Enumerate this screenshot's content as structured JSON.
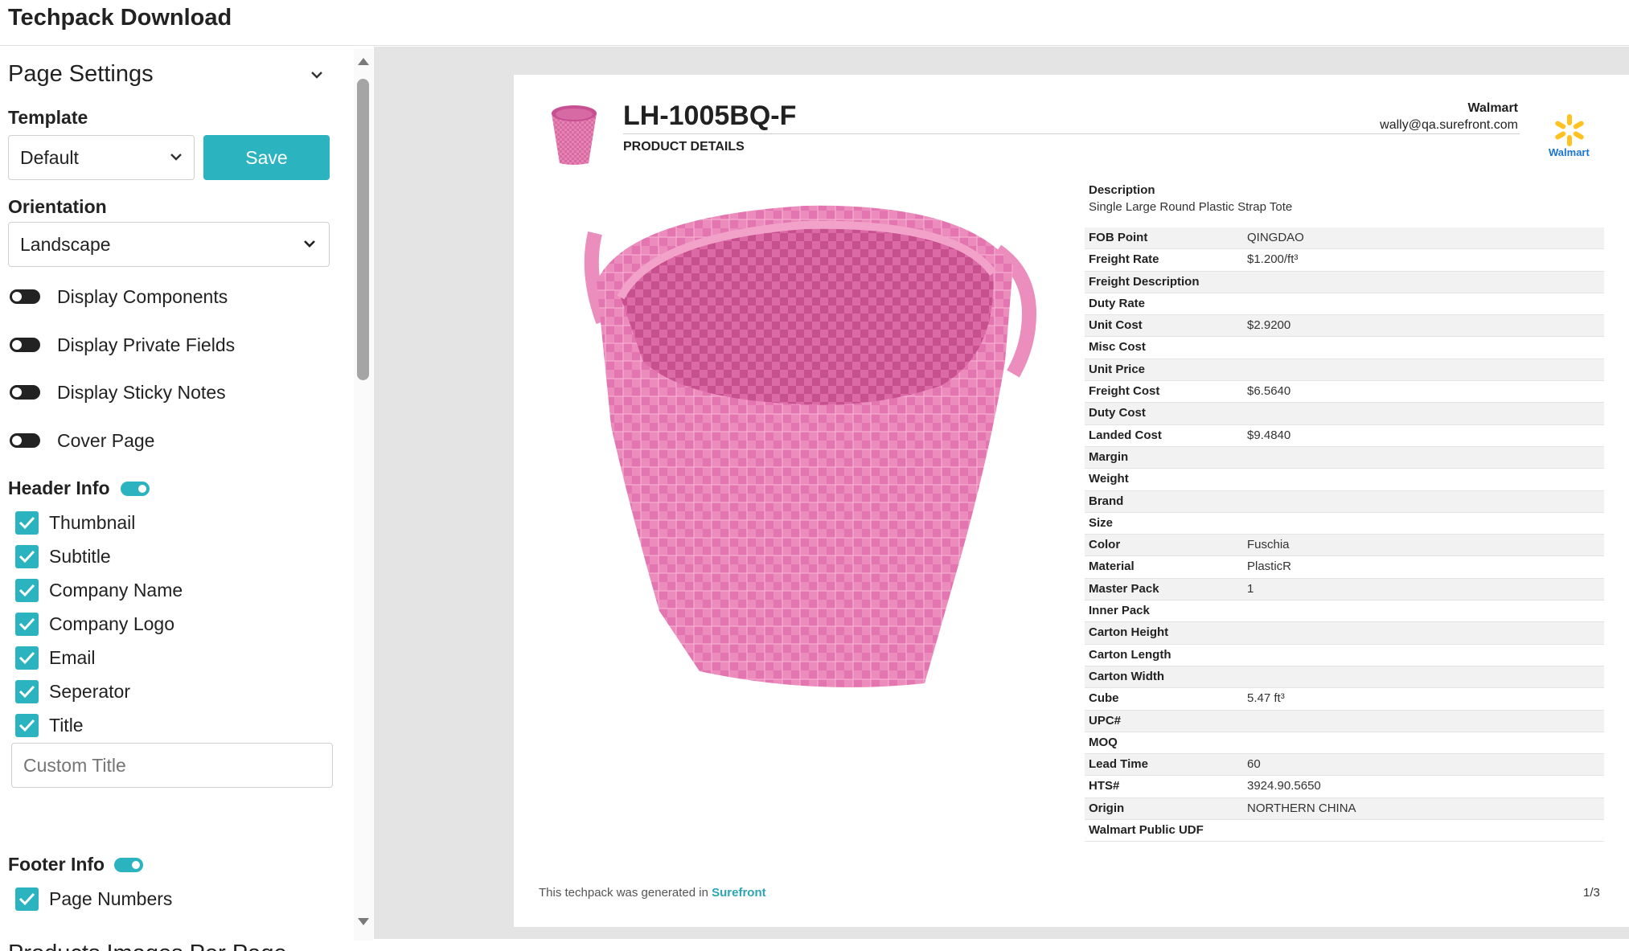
{
  "app": {
    "title": "Techpack Download"
  },
  "sidebar": {
    "page_settings": "Page Settings",
    "template_label": "Template",
    "template_value": "Default",
    "save_label": "Save",
    "orientation_label": "Orientation",
    "orientation_value": "Landscape",
    "toggles": [
      {
        "label": "Display Components",
        "on": false
      },
      {
        "label": "Display Private Fields",
        "on": false
      },
      {
        "label": "Display Sticky Notes",
        "on": false
      },
      {
        "label": "Cover Page",
        "on": false
      }
    ],
    "header_info": "Header Info",
    "header_checks": [
      {
        "label": "Thumbnail",
        "checked": true
      },
      {
        "label": "Subtitle",
        "checked": true
      },
      {
        "label": "Company Name",
        "checked": true
      },
      {
        "label": "Company Logo",
        "checked": true
      },
      {
        "label": "Email",
        "checked": true
      },
      {
        "label": "Seperator",
        "checked": true
      },
      {
        "label": "Title",
        "checked": true
      }
    ],
    "custom_title_placeholder": "Custom Title",
    "footer_info": "Footer Info",
    "footer_checks": [
      {
        "label": "Page Numbers",
        "checked": true
      }
    ],
    "products_images": "Products Images Per Page"
  },
  "preview": {
    "product_title": "LH-1005BQ-F",
    "subtitle": "PRODUCT DETAILS",
    "company": "Walmart",
    "email": "wally@qa.surefront.com",
    "logo_text": "Walmart",
    "description_label": "Description",
    "description_value": "Single Large Round Plastic Strap Tote",
    "attributes": [
      {
        "k": "FOB Point",
        "v": "QINGDAO"
      },
      {
        "k": "Freight Rate",
        "v": "$1.200/ft³"
      },
      {
        "k": "Freight Description",
        "v": ""
      },
      {
        "k": "Duty Rate",
        "v": ""
      },
      {
        "k": "Unit Cost",
        "v": "$2.9200"
      },
      {
        "k": "Misc Cost",
        "v": ""
      },
      {
        "k": "Unit Price",
        "v": ""
      },
      {
        "k": "Freight Cost",
        "v": "$6.5640"
      },
      {
        "k": "Duty Cost",
        "v": ""
      },
      {
        "k": "Landed Cost",
        "v": "$9.4840"
      },
      {
        "k": "Margin",
        "v": ""
      },
      {
        "k": "Weight",
        "v": ""
      },
      {
        "k": "Brand",
        "v": ""
      },
      {
        "k": "Size",
        "v": ""
      },
      {
        "k": "Color",
        "v": "Fuschia"
      },
      {
        "k": "Material",
        "v": "PlasticR"
      },
      {
        "k": "Master Pack",
        "v": "1"
      },
      {
        "k": "Inner Pack",
        "v": ""
      },
      {
        "k": "Carton Height",
        "v": ""
      },
      {
        "k": "Carton Length",
        "v": ""
      },
      {
        "k": "Carton Width",
        "v": ""
      },
      {
        "k": "Cube",
        "v": "5.47 ft³"
      },
      {
        "k": "UPC#",
        "v": ""
      },
      {
        "k": "MOQ",
        "v": ""
      },
      {
        "k": "Lead Time",
        "v": "60"
      },
      {
        "k": "HTS#",
        "v": "3924.90.5650"
      },
      {
        "k": "Origin",
        "v": "NORTHERN CHINA"
      },
      {
        "k": "Walmart Public UDF",
        "v": ""
      }
    ],
    "footer_text": "This techpack was generated in",
    "footer_brand": "Surefront",
    "page_number": "1/3"
  },
  "colors": {
    "accent": "#2bb3bf",
    "product_pink": "#e97fb3"
  }
}
